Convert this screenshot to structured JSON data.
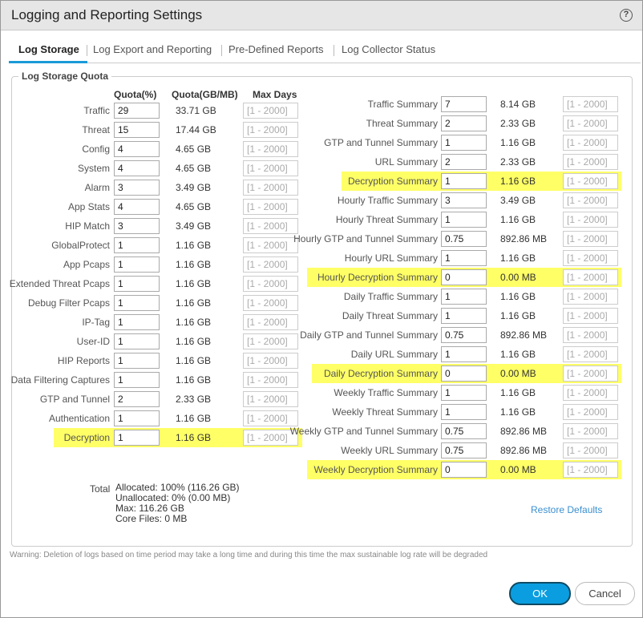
{
  "dialog": {
    "title": "Logging and Reporting Settings",
    "help_icon": "?"
  },
  "tabs": [
    {
      "label": "Log Storage",
      "active": true
    },
    {
      "label": "Log Export and Reporting"
    },
    {
      "label": "Pre-Defined Reports"
    },
    {
      "label": "Log Collector Status"
    }
  ],
  "quota": {
    "legend": "Log Storage Quota",
    "headers": {
      "percent": "Quota(%)",
      "size": "Quota(GB/MB)",
      "max_days": "Max Days"
    },
    "highlight_color": "#ffff66",
    "left_rows": [
      {
        "label": "Traffic",
        "percent": "29",
        "size": "33.71 GB",
        "max_days": "[1 - 2000]"
      },
      {
        "label": "Threat",
        "percent": "15",
        "size": "17.44 GB",
        "max_days": "[1 - 2000]"
      },
      {
        "label": "Config",
        "percent": "4",
        "size": "4.65 GB",
        "max_days": "[1 - 2000]"
      },
      {
        "label": "System",
        "percent": "4",
        "size": "4.65 GB",
        "max_days": "[1 - 2000]"
      },
      {
        "label": "Alarm",
        "percent": "3",
        "size": "3.49 GB",
        "max_days": "[1 - 2000]"
      },
      {
        "label": "App Stats",
        "percent": "4",
        "size": "4.65 GB",
        "max_days": "[1 - 2000]"
      },
      {
        "label": "HIP Match",
        "percent": "3",
        "size": "3.49 GB",
        "max_days": "[1 - 2000]"
      },
      {
        "label": "GlobalProtect",
        "percent": "1",
        "size": "1.16 GB",
        "max_days": "[1 - 2000]"
      },
      {
        "label": "App Pcaps",
        "percent": "1",
        "size": "1.16 GB",
        "max_days": "[1 - 2000]"
      },
      {
        "label": "Extended Threat Pcaps",
        "percent": "1",
        "size": "1.16 GB",
        "max_days": "[1 - 2000]"
      },
      {
        "label": "Debug Filter Pcaps",
        "percent": "1",
        "size": "1.16 GB",
        "max_days": "[1 - 2000]"
      },
      {
        "label": "IP-Tag",
        "percent": "1",
        "size": "1.16 GB",
        "max_days": "[1 - 2000]"
      },
      {
        "label": "User-ID",
        "percent": "1",
        "size": "1.16 GB",
        "max_days": "[1 - 2000]"
      },
      {
        "label": "HIP Reports",
        "percent": "1",
        "size": "1.16 GB",
        "max_days": "[1 - 2000]"
      },
      {
        "label": "Data Filtering Captures",
        "percent": "1",
        "size": "1.16 GB",
        "max_days": "[1 - 2000]"
      },
      {
        "label": "GTP and Tunnel",
        "percent": "2",
        "size": "2.33 GB",
        "max_days": "[1 - 2000]"
      },
      {
        "label": "Authentication",
        "percent": "1",
        "size": "1.16 GB",
        "max_days": "[1 - 2000]"
      },
      {
        "label": "Decryption",
        "percent": "1",
        "size": "1.16 GB",
        "max_days": "[1 - 2000]",
        "highlighted": true
      }
    ],
    "right_rows": [
      {
        "label": "Traffic Summary",
        "percent": "7",
        "size": "8.14 GB",
        "max_days": "[1 - 2000]"
      },
      {
        "label": "Threat Summary",
        "percent": "2",
        "size": "2.33 GB",
        "max_days": "[1 - 2000]"
      },
      {
        "label": "GTP and Tunnel Summary",
        "percent": "1",
        "size": "1.16 GB",
        "max_days": "[1 - 2000]"
      },
      {
        "label": "URL Summary",
        "percent": "2",
        "size": "2.33 GB",
        "max_days": "[1 - 2000]"
      },
      {
        "label": "Decryption Summary",
        "percent": "1",
        "size": "1.16 GB",
        "max_days": "[1 - 2000]",
        "highlighted": true
      },
      {
        "label": "Hourly Traffic Summary",
        "percent": "3",
        "size": "3.49 GB",
        "max_days": "[1 - 2000]"
      },
      {
        "label": "Hourly Threat Summary",
        "percent": "1",
        "size": "1.16 GB",
        "max_days": "[1 - 2000]"
      },
      {
        "label": "Hourly GTP and Tunnel Summary",
        "percent": "0.75",
        "size": "892.86 MB",
        "max_days": "[1 - 2000]"
      },
      {
        "label": "Hourly URL Summary",
        "percent": "1",
        "size": "1.16 GB",
        "max_days": "[1 - 2000]"
      },
      {
        "label": "Hourly Decryption Summary",
        "percent": "0",
        "size": "0.00 MB",
        "max_days": "[1 - 2000]",
        "highlighted": true
      },
      {
        "label": "Daily Traffic Summary",
        "percent": "1",
        "size": "1.16 GB",
        "max_days": "[1 - 2000]"
      },
      {
        "label": "Daily Threat Summary",
        "percent": "1",
        "size": "1.16 GB",
        "max_days": "[1 - 2000]"
      },
      {
        "label": "Daily GTP and Tunnel Summary",
        "percent": "0.75",
        "size": "892.86 MB",
        "max_days": "[1 - 2000]"
      },
      {
        "label": "Daily URL Summary",
        "percent": "1",
        "size": "1.16 GB",
        "max_days": "[1 - 2000]"
      },
      {
        "label": "Daily Decryption Summary",
        "percent": "0",
        "size": "0.00 MB",
        "max_days": "[1 - 2000]",
        "highlighted": true
      },
      {
        "label": "Weekly Traffic Summary",
        "percent": "1",
        "size": "1.16 GB",
        "max_days": "[1 - 2000]"
      },
      {
        "label": "Weekly Threat Summary",
        "percent": "1",
        "size": "1.16 GB",
        "max_days": "[1 - 2000]"
      },
      {
        "label": "Weekly GTP and Tunnel Summary",
        "percent": "0.75",
        "size": "892.86 MB",
        "max_days": "[1 - 2000]"
      },
      {
        "label": "Weekly URL Summary",
        "percent": "0.75",
        "size": "892.86 MB",
        "max_days": "[1 - 2000]"
      },
      {
        "label": "Weekly Decryption Summary",
        "percent": "0",
        "size": "0.00 MB",
        "max_days": "[1 - 2000]",
        "highlighted": true
      }
    ],
    "total": {
      "label": "Total",
      "allocated": "Allocated: 100% (116.26 GB)",
      "unallocated": "Unallocated: 0% (0.00 MB)",
      "max": "Max: 116.26 GB",
      "core_files": "Core Files: 0 MB"
    },
    "restore_defaults": "Restore Defaults"
  },
  "warning": "Warning: Deletion of logs based on time period may take a long time and during this time the max sustainable log rate will be degraded",
  "buttons": {
    "ok": "OK",
    "cancel": "Cancel"
  }
}
